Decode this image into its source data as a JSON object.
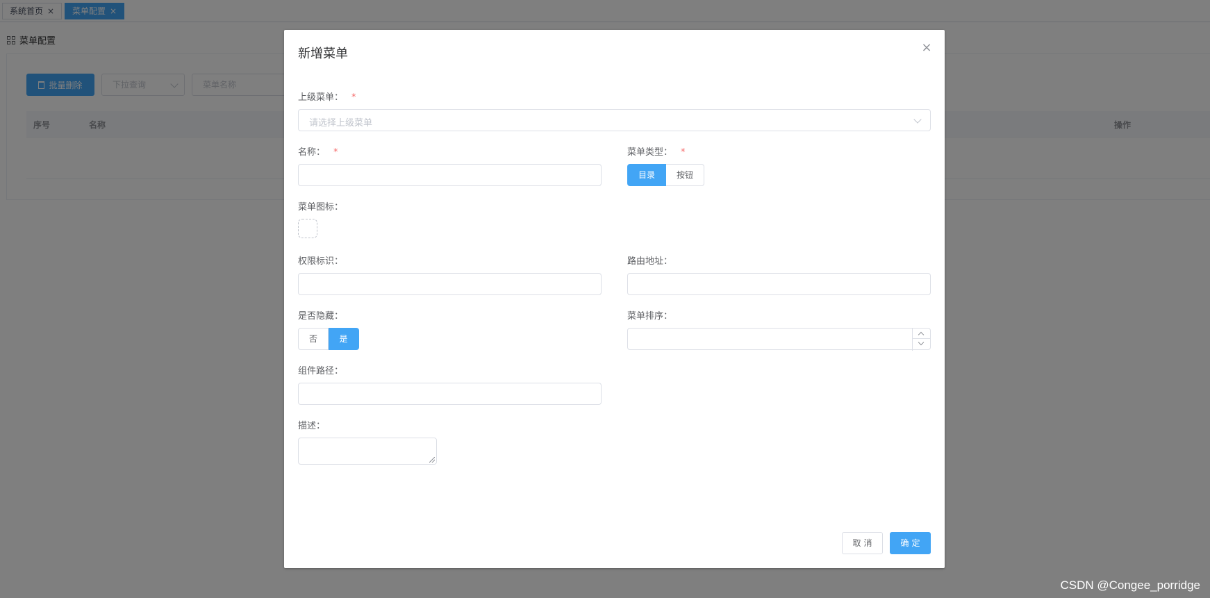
{
  "tabs": [
    {
      "label": "系统首页",
      "close": "×"
    },
    {
      "label": "菜单配置",
      "close": "×"
    }
  ],
  "page": {
    "title": "菜单配置",
    "batch_delete_label": "批量删除",
    "query_select_placeholder": "下拉查询",
    "name_search_placeholder": "菜单名称",
    "table_headers": {
      "index": "序号",
      "name": "名称",
      "actions": "操作"
    }
  },
  "dialog": {
    "title": "新增菜单",
    "close": "×",
    "parent_menu": {
      "label": "上级菜单：",
      "required": "*",
      "placeholder": "请选择上级菜单"
    },
    "name": {
      "label": "名称：",
      "required": "*",
      "value": ""
    },
    "menu_type": {
      "label": "菜单类型：",
      "required": "*",
      "options": [
        "目录",
        "按钮"
      ],
      "selected": "目录"
    },
    "menu_icon": {
      "label": "菜单图标："
    },
    "permission": {
      "label": "权限标识：",
      "value": ""
    },
    "route": {
      "label": "路由地址：",
      "value": ""
    },
    "hidden": {
      "label": "是否隐藏：",
      "options": [
        "否",
        "是"
      ],
      "selected": "是"
    },
    "sort": {
      "label": "菜单排序：",
      "value": ""
    },
    "component": {
      "label": "组件路径：",
      "value": ""
    },
    "description": {
      "label": "描述：",
      "value": ""
    },
    "cancel_label": "取消",
    "confirm_label": "确定"
  },
  "watermark": "CSDN @Congee_porridge",
  "colors": {
    "primary": "#42a5f5",
    "required": "#f56c6c",
    "mask": "rgba(0,0,0,0.5)"
  }
}
